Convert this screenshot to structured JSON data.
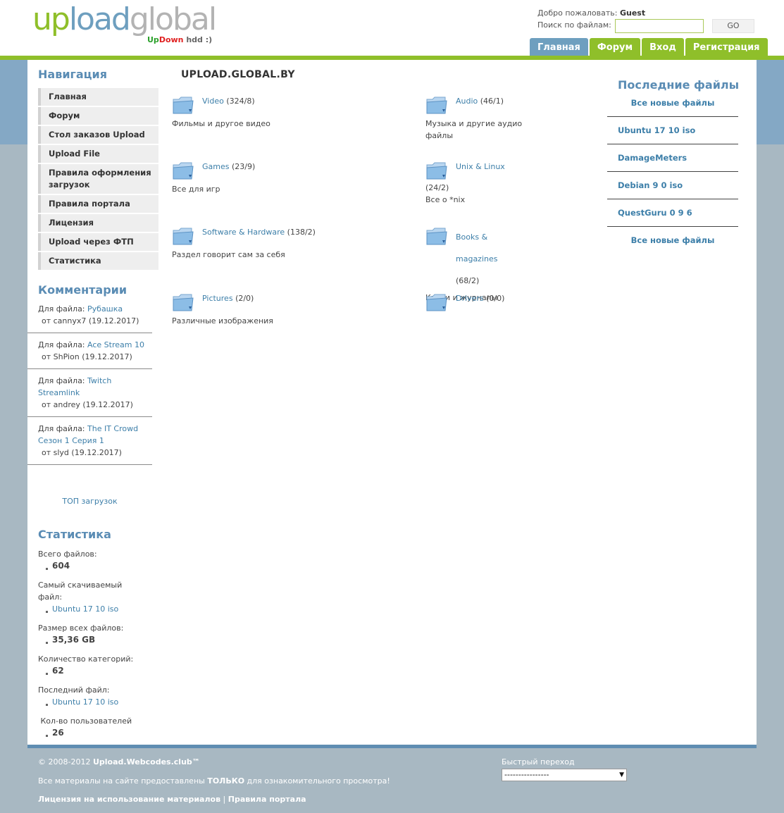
{
  "header": {
    "logo": {
      "up": "up",
      "load": "load",
      "global": "global",
      "tag_up": "Up",
      "tag_down": "Down",
      "tag_rest": " hdd :)"
    },
    "welcome_prefix": "Добро пожаловать:",
    "welcome_user": "Guest",
    "search_label": "Поиск по файлам:",
    "search_value": "",
    "go_label": "GO",
    "tabs": [
      {
        "label": "Главная",
        "active": true
      },
      {
        "label": "Форум",
        "active": false
      },
      {
        "label": "Вход",
        "active": false
      },
      {
        "label": "Регистрация",
        "active": false
      }
    ]
  },
  "colors": {
    "green": "#8fbf2a",
    "blue": "#6e9fbf",
    "link": "#3d7fa9",
    "band": "#84a8c5",
    "page_bg": "#a8b8c2"
  },
  "sidebar": {
    "nav_title": "Навигация",
    "nav_items": [
      "Главная",
      "Форум",
      "Стол заказов Upload",
      "Upload File",
      "Правила оформления загрузок",
      "Правила портала",
      "Лицензия",
      "Upload через ФТП",
      "Статистика"
    ],
    "comments_title": "Комментарии",
    "comment_prefix": "Для файла: ",
    "comments": [
      {
        "file": "Рубашка",
        "by": "от cannyx7 (19.12.2017)"
      },
      {
        "file": "Ace Stream 10",
        "by": "от ShPion (19.12.2017)"
      },
      {
        "file": "Twitch Streamlink",
        "by": "от andrey (19.12.2017)"
      },
      {
        "file": "The IT Crowd Сезон 1 Серия 1",
        "by": "от slyd (19.12.2017)"
      }
    ],
    "top_downloads": "ТОП загрузок",
    "stats_title": "Статистика",
    "stats": [
      {
        "label": "Всего файлов:",
        "value": "604",
        "link": false
      },
      {
        "label": "Самый скачиваемый файл:",
        "value": "Ubuntu 17 10 iso",
        "link": true
      },
      {
        "label": "Размер всех файлов:",
        "value": "35,36 GB",
        "link": false
      },
      {
        "label": "Количество категорий:",
        "value": "62",
        "link": false
      },
      {
        "label": "Последний файл:",
        "value": "Ubuntu 17 10 iso",
        "link": true
      },
      {
        "label": " Кол-во пользователей",
        "value": "26",
        "link": false
      }
    ]
  },
  "main": {
    "heading": "UPLOAD.GLOBAL.BY",
    "categories": [
      {
        "name": "Video",
        "count": "(324/8)",
        "desc": "Фильмы и другое видео"
      },
      {
        "name": "Audio",
        "count": "(46/1)",
        "desc": "Музыка и другие аудио файлы"
      },
      {
        "name": "Games",
        "count": "(23/9)",
        "desc": "Все для игр"
      },
      {
        "name": "Unix & Linux",
        "count": "(24/2)",
        "desc": "Все о *nix"
      },
      {
        "name": "Software & Hardware",
        "count": "(138/2)",
        "desc": "Раздел говорит сам за себя"
      },
      {
        "name": "Books & magazines",
        "count": "(68/2)",
        "desc": "Книги и журналы"
      },
      {
        "name": "Pictures",
        "count": "(2/0)",
        "desc": "Различные изображения"
      },
      {
        "name": "Drivers",
        "count": "(0/0)",
        "desc": ""
      }
    ]
  },
  "recent": {
    "title": "Последние файлы",
    "all_new": "Все новые файлы",
    "items": [
      "Ubuntu 17 10 iso",
      "DamageMeters",
      "Debian 9 0 iso",
      "QuestGuru 0 9 6"
    ]
  },
  "footer": {
    "copy_prefix": "© 2008-2012 ",
    "copy_site": "Upload.Webcodes.club™",
    "note_prefix": "Все материалы на сайте предоставлены ",
    "note_bold": "ТОЛЬКО",
    "note_suffix": " для ознакомительного просмотра!",
    "license_link": "Лицензия на использование материалов",
    "sep": " | ",
    "rules_link": "Правила портала",
    "quick_label": "Быстрый переход",
    "quick_value": "----------------"
  }
}
